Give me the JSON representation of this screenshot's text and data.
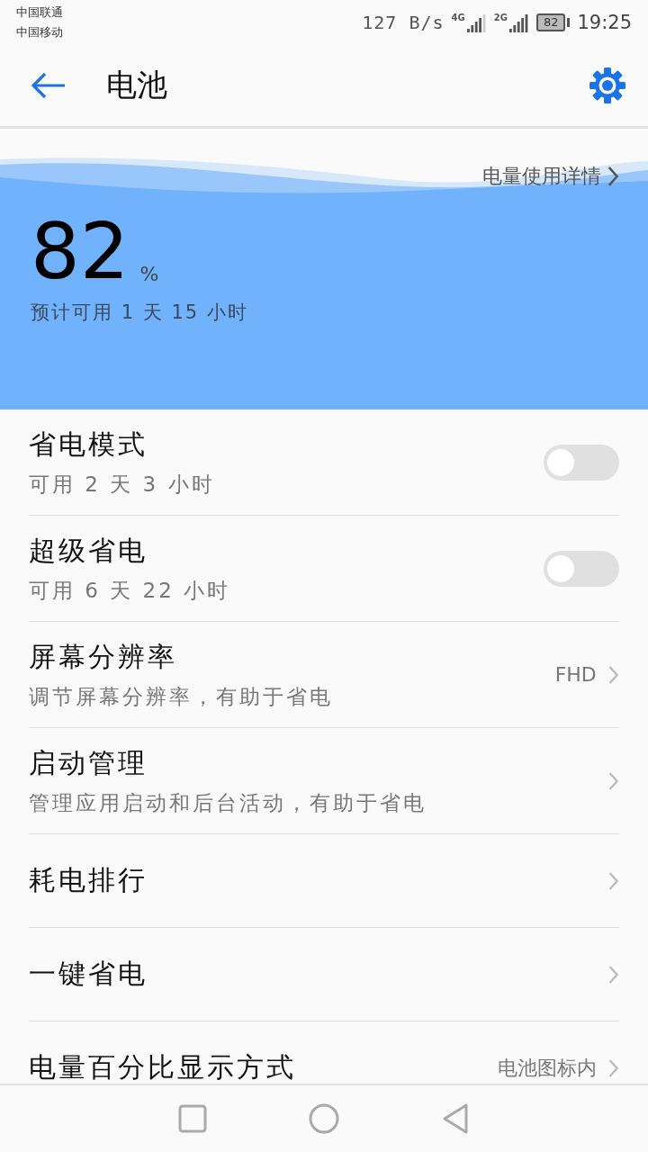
{
  "status_bar": {
    "carriers": [
      "中国联通",
      "中国移动"
    ],
    "speed": "127 B/s",
    "sim1_network": "4G",
    "sim2_network": "2G",
    "battery": "82",
    "time": "19:25"
  },
  "header": {
    "title": "电池"
  },
  "battery_panel": {
    "details_link": "电量使用详情",
    "percent": "82",
    "unit": "%",
    "estimate": "预计可用 1 天 15 小时"
  },
  "settings": [
    {
      "kind": "toggle",
      "title": "省电模式",
      "subtitle": "可用 2 天 3 小时",
      "on": false
    },
    {
      "kind": "toggle",
      "title": "超级省电",
      "subtitle": "可用 6 天 22 小时",
      "on": false
    },
    {
      "kind": "link",
      "title": "屏幕分辨率",
      "subtitle": "调节屏幕分辨率，有助于省电",
      "value": "FHD"
    },
    {
      "kind": "link",
      "title": "启动管理",
      "subtitle": "管理应用启动和后台活动，有助于省电"
    },
    {
      "kind": "link",
      "title": "耗电排行"
    },
    {
      "kind": "link",
      "title": "一键省电"
    },
    {
      "kind": "link",
      "title": "电量百分比显示方式",
      "value": "电池图标内"
    }
  ]
}
